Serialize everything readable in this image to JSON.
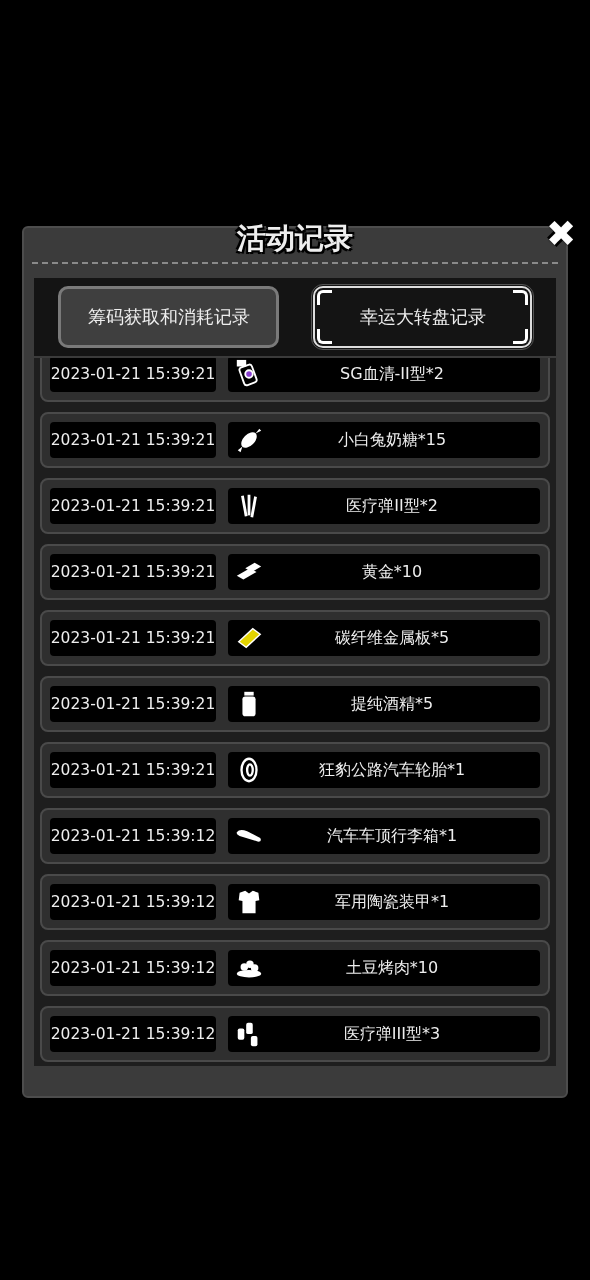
{
  "title": "活动记录",
  "close": "✖",
  "tabs": [
    {
      "label": "筹码获取和消耗记录",
      "selected": false
    },
    {
      "label": "幸运大转盘记录",
      "selected": true
    }
  ],
  "records": [
    {
      "time": "2023-01-21 15:39:21",
      "item": "SG血清-II型*2"
    },
    {
      "time": "2023-01-21 15:39:21",
      "item": "小白兔奶糖*15"
    },
    {
      "time": "2023-01-21 15:39:21",
      "item": "医疗弹II型*2"
    },
    {
      "time": "2023-01-21 15:39:21",
      "item": "黄金*10"
    },
    {
      "time": "2023-01-21 15:39:21",
      "item": "碳纤维金属板*5"
    },
    {
      "time": "2023-01-21 15:39:21",
      "item": "提纯酒精*5"
    },
    {
      "time": "2023-01-21 15:39:21",
      "item": "狂豹公路汽车轮胎*1"
    },
    {
      "time": "2023-01-21 15:39:12",
      "item": "汽车车顶行李箱*1"
    },
    {
      "time": "2023-01-21 15:39:12",
      "item": "军用陶瓷装甲*1"
    },
    {
      "time": "2023-01-21 15:39:12",
      "item": "土豆烤肉*10"
    },
    {
      "time": "2023-01-21 15:39:12",
      "item": "医疗弹III型*3"
    }
  ]
}
